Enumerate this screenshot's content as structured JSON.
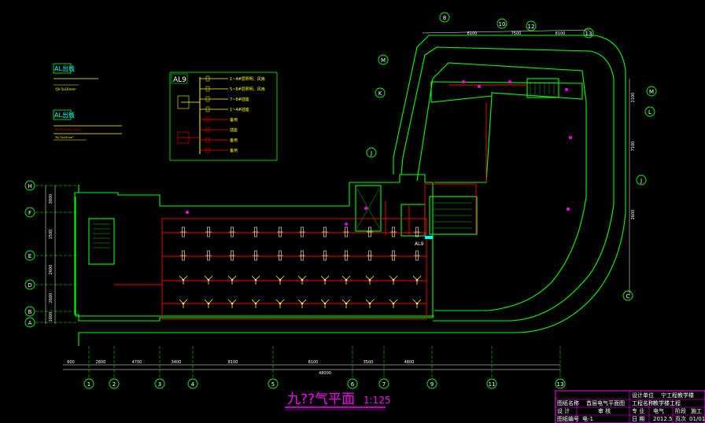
{
  "drawing": {
    "title": "九??气平面",
    "scale": "1:125"
  },
  "panels": {
    "al_top": {
      "label": "AL出线",
      "line1": "YJV-5x16mm²"
    },
    "al_bottom": {
      "label": "AL出线",
      "line1": "ZR-YJV-4x35+1x16",
      "line2": "YJV-5x25mm²"
    },
    "al9": {
      "label": "AL9",
      "rows": [
        "1~4#层照明、风扇",
        "5~8#层照明、风扇",
        "7~8#插座",
        "1~4#插座",
        "备用",
        "插座",
        "备用",
        "备用"
      ]
    }
  },
  "labels": {
    "al9_floor": "AL9",
    "al_tag": "AL9",
    "dim_total": "48000"
  },
  "axes": {
    "bottom": [
      "1",
      "2",
      "3",
      "4",
      "5",
      "6",
      "7",
      "9",
      "11",
      "13"
    ],
    "left": [
      "H",
      "F",
      "E",
      "D",
      "B",
      "A"
    ],
    "top": [
      "8",
      "10",
      "12",
      "13"
    ],
    "right_outer": [
      "M",
      "L",
      "J",
      "C"
    ],
    "right_inner": [
      "M",
      "K",
      "J"
    ]
  },
  "dims_bottom": [
    "600",
    "2800",
    "4700",
    "3400",
    "8100",
    "8100",
    "3500",
    "4800"
  ],
  "dims_left": [
    "3000",
    "1500",
    "2600",
    "2600",
    "1000"
  ],
  "dims_top": [
    "8100",
    "7500",
    "8100"
  ],
  "dims_right": [
    "2100",
    "7100",
    "2600"
  ],
  "title_block": {
    "project_company": "设计单位",
    "project": "宁工程教学楼",
    "drawing_name_label": "图纸名称",
    "drawing_name": "首层电气平面图",
    "project_name_label": "工程名称",
    "project_name": "教学楼工程",
    "design": "设 计",
    "check": "审 核",
    "discipline_label": "专 业",
    "discipline": "电气",
    "stage_label": "阶段",
    "stage": "施工",
    "drawing_no_label": "图纸编号",
    "drawing_no": "电-1",
    "date_label": "日 期",
    "date": "2012.5",
    "sheet_label": "页次",
    "sheet": "01/01"
  },
  "colors": {
    "wall": "#00ff00",
    "circuit": "#ff0000",
    "fixture": "#ffff00",
    "dim": "#ffffff",
    "axis": "#ffffff",
    "title": "#ff00ff"
  }
}
